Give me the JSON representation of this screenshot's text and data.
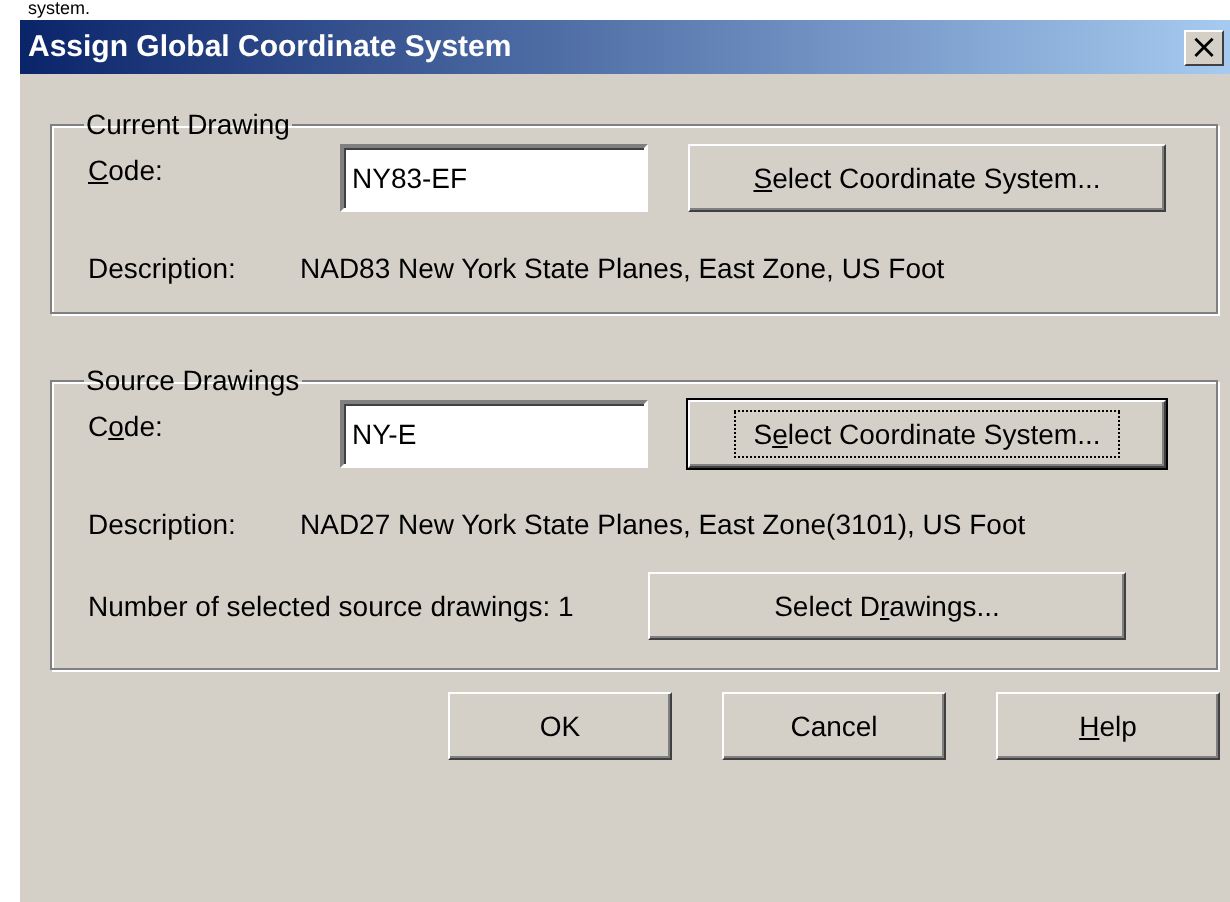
{
  "page_text": "system.",
  "window": {
    "title": "Assign Global Coordinate System",
    "close": "×"
  },
  "groups": [
    {
      "title": "Current Drawing",
      "code_label": {
        "key": "C",
        "after": "ode:"
      },
      "code_value": "NY83-EF",
      "select_button": {
        "key": "S",
        "after": "elect Coordinate System...",
        "default": false
      },
      "description_label": "Description:",
      "description": "NAD83 New York State Planes, East Zone, US Foot"
    },
    {
      "title": "Source Drawings",
      "code_label": {
        "before": "C",
        "key": "o",
        "after": "de:"
      },
      "code_value": "NY-E",
      "select_button": {
        "before": "S",
        "key": "e",
        "after": "lect Coordinate System...",
        "default": true
      },
      "description_label": "Description:",
      "description": "NAD27 New York State Planes, East Zone(3101), US Foot",
      "count_text": "Number of selected source drawings: 1",
      "drawings_button": {
        "before": "Select D",
        "key": "r",
        "after": "awings...",
        "default": false
      }
    }
  ],
  "buttons": [
    {
      "before": "OK",
      "default": false
    },
    {
      "before": "Cancel",
      "default": false
    },
    {
      "key": "H",
      "after": "elp",
      "default": false
    }
  ]
}
